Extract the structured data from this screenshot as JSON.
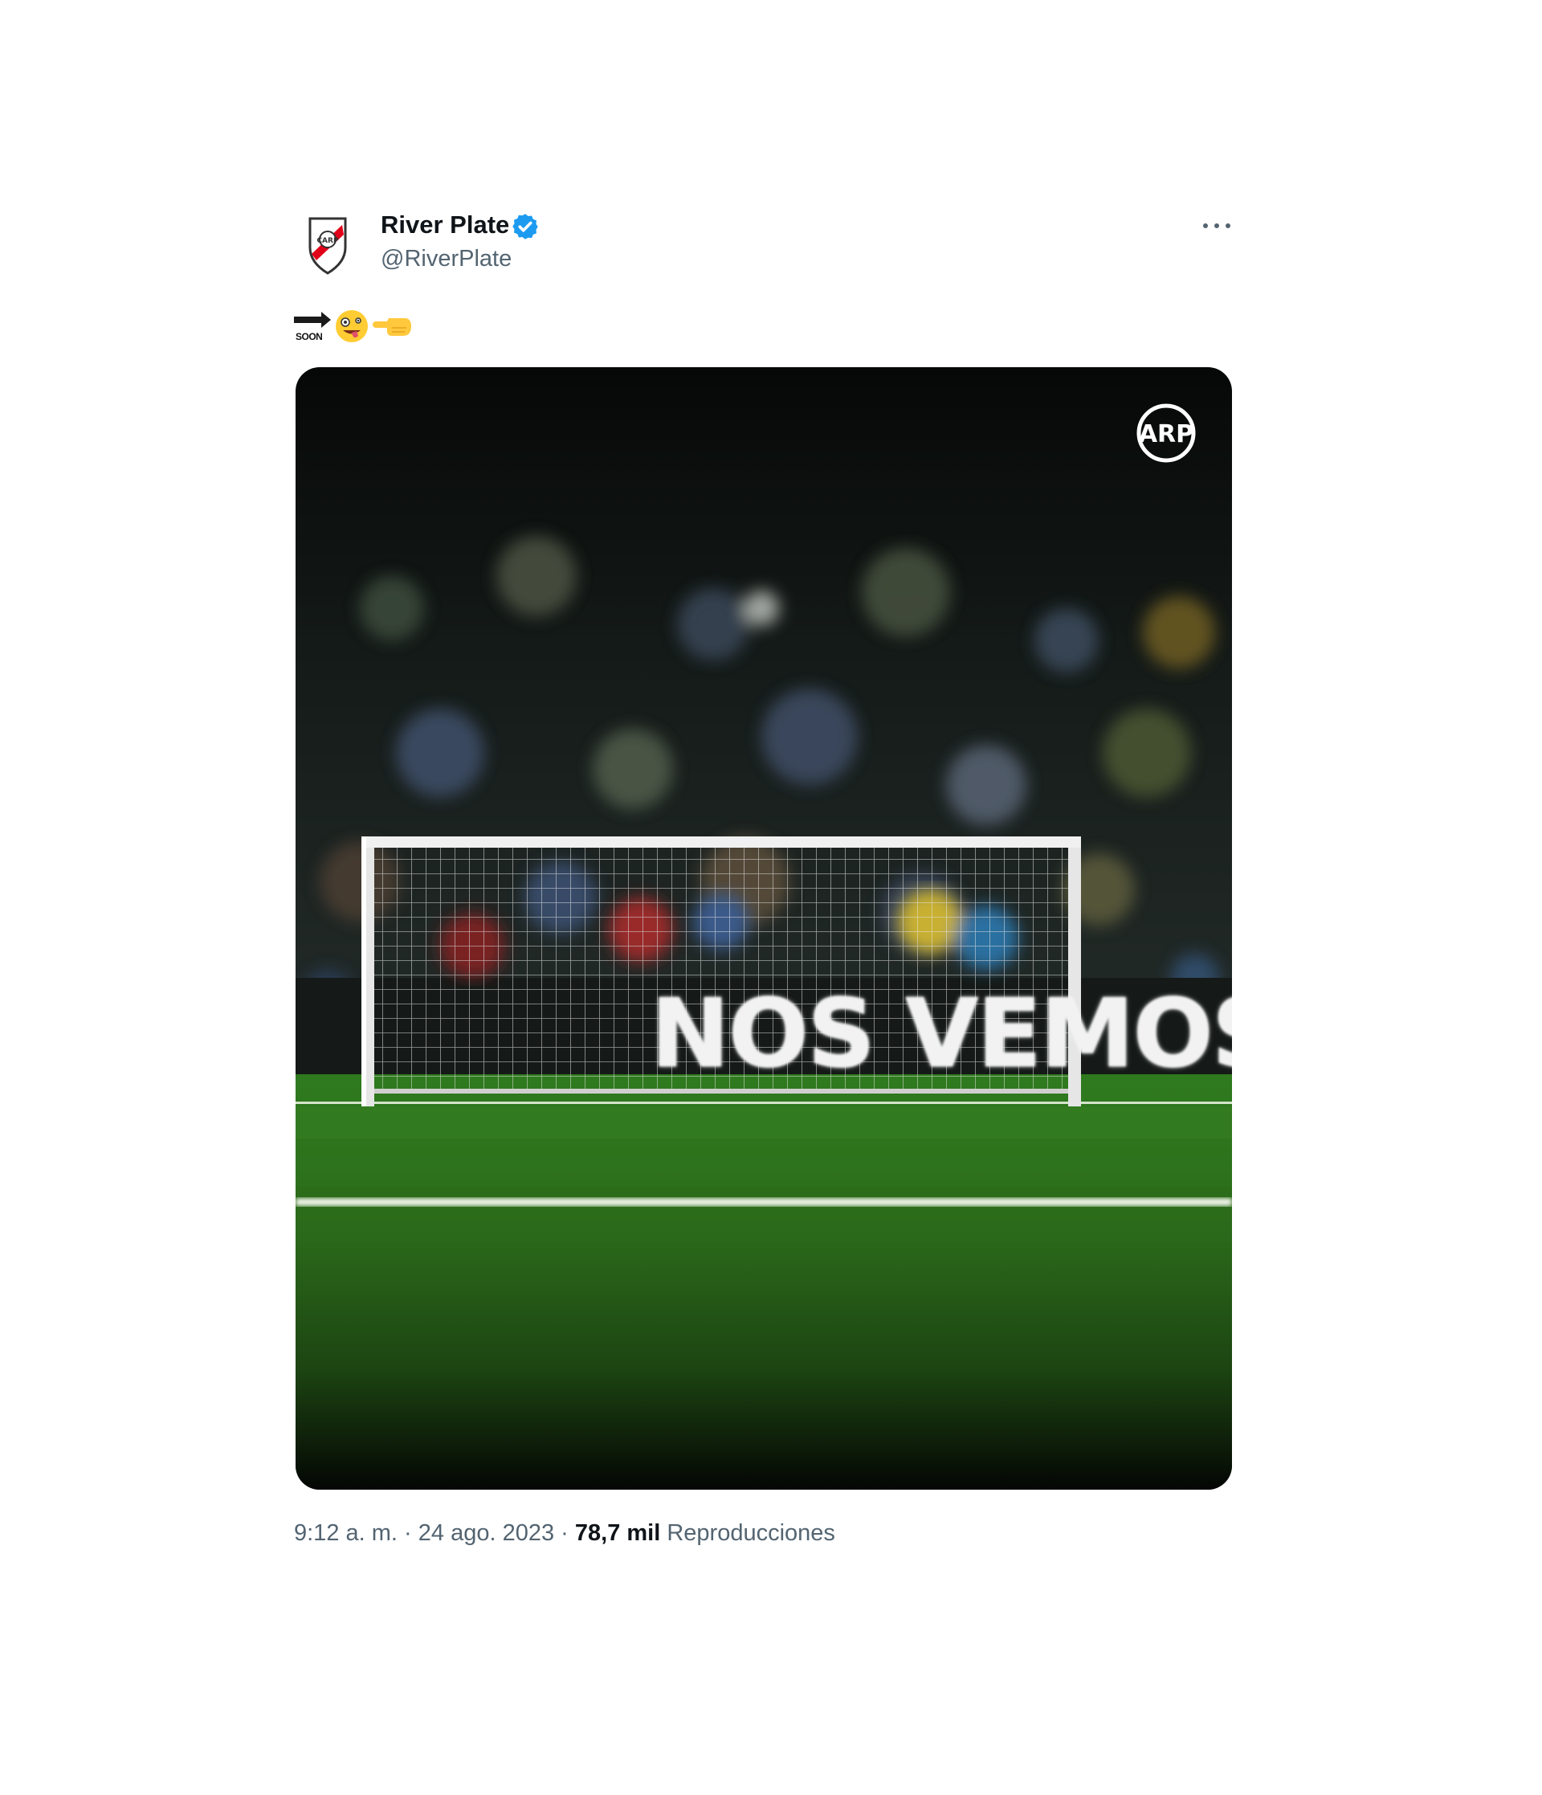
{
  "author": {
    "name": "River Plate",
    "handle": "@RiverPlate",
    "verified": true
  },
  "tweet": {
    "text_emojis": [
      "soon-arrow",
      "zany-face",
      "backhand-index-pointing-left"
    ],
    "soon_label": "SOON",
    "media_text": "NOS VEMOS"
  },
  "meta": {
    "time": "9:12 a. m.",
    "separator": "·",
    "date": "24 ago. 2023",
    "views_count": "78,7 mil",
    "views_label": "Reproducciones"
  },
  "colors": {
    "text_primary": "#0f1419",
    "text_secondary": "#536471",
    "verified_blue": "#1d9bf0",
    "river_red": "#e1001a"
  }
}
